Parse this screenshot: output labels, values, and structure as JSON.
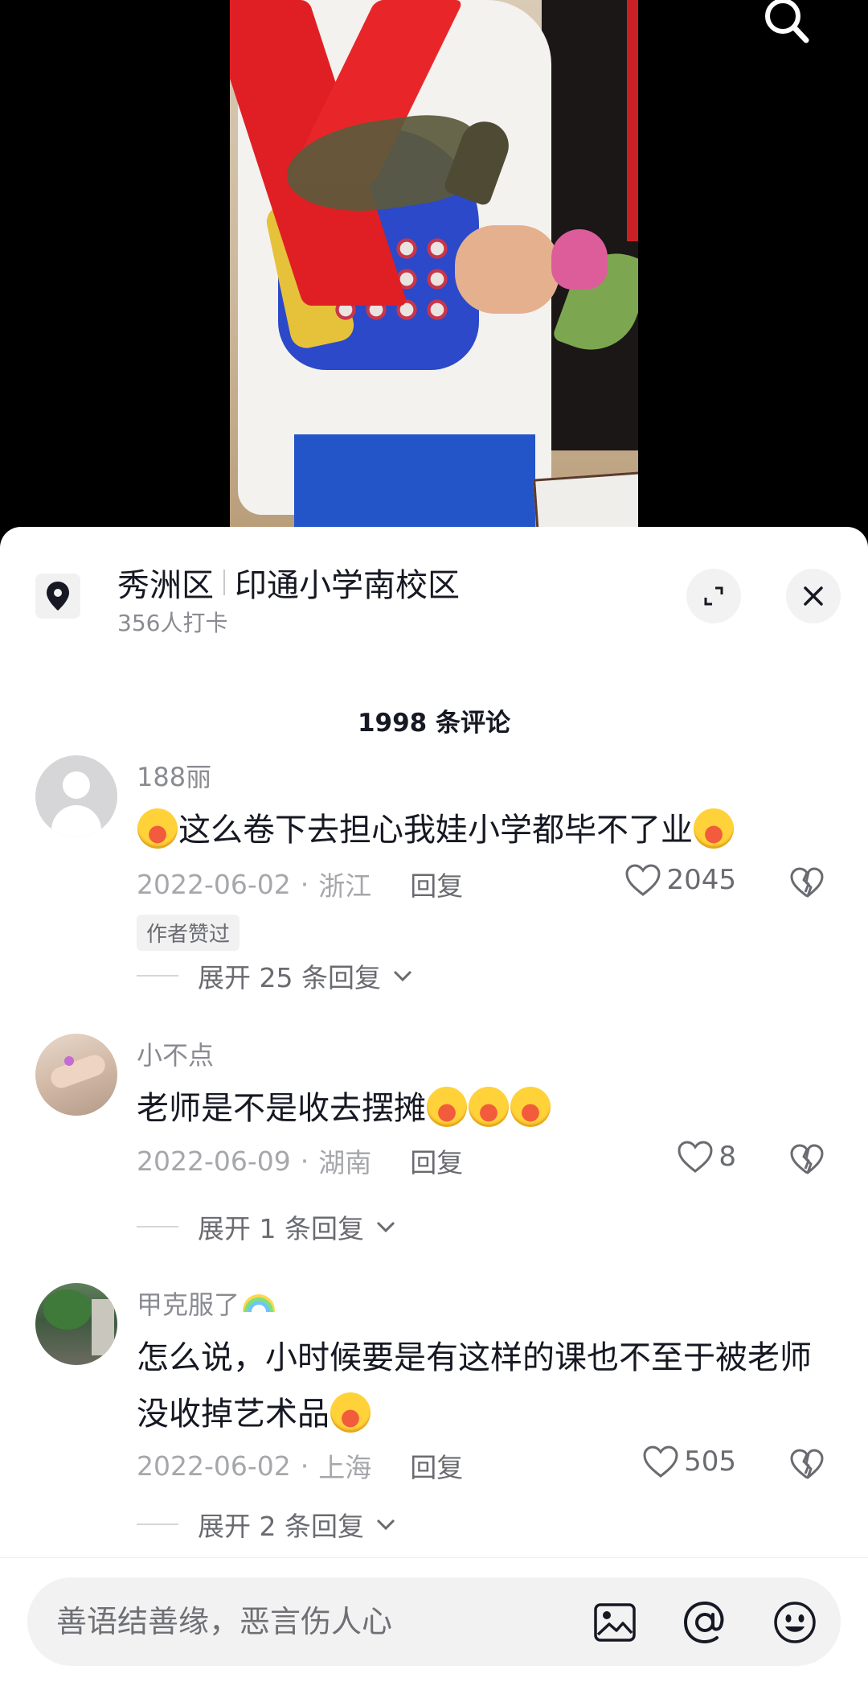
{
  "location": {
    "district": "秀洲区",
    "place": "印通小学南校区",
    "checkins": "356人打卡"
  },
  "comments_header": "1998 条评论",
  "comments": [
    {
      "user": "188丽",
      "text_parts": [
        "这么卷下去担心我娃小学都毕不了业"
      ],
      "date": "2022-06-02",
      "region": "浙江",
      "reply_label": "回复",
      "likes": "2045",
      "tag": "作者赞过",
      "expand": "展开 25 条回复"
    },
    {
      "user": "小不点",
      "text": "老师是不是收去摆摊",
      "date": "2022-06-09",
      "region": "湖南",
      "reply_label": "回复",
      "likes": "8",
      "expand": "展开 1 条回复"
    },
    {
      "user": "甲克服了",
      "text": "怎么说，小时候要是有这样的课也不至于被老师没收掉艺术品",
      "date": "2022-06-02",
      "region": "上海",
      "reply_label": "回复",
      "likes": "505",
      "expand": "展开 2 条回复"
    }
  ],
  "input": {
    "placeholder": "善语结善缘，恶言伤人心"
  },
  "icons": {
    "search": "search-icon",
    "location": "location-pin-icon",
    "expand": "expand-icon",
    "close": "close-icon",
    "like": "heart-icon",
    "dislike": "broken-heart-icon",
    "chevron": "chevron-down-icon",
    "image": "image-icon",
    "mention": "at-icon",
    "emoji": "smiley-icon",
    "crying_laugh": "crying-laughing-emoji",
    "rainbow": "rainbow-emoji"
  }
}
